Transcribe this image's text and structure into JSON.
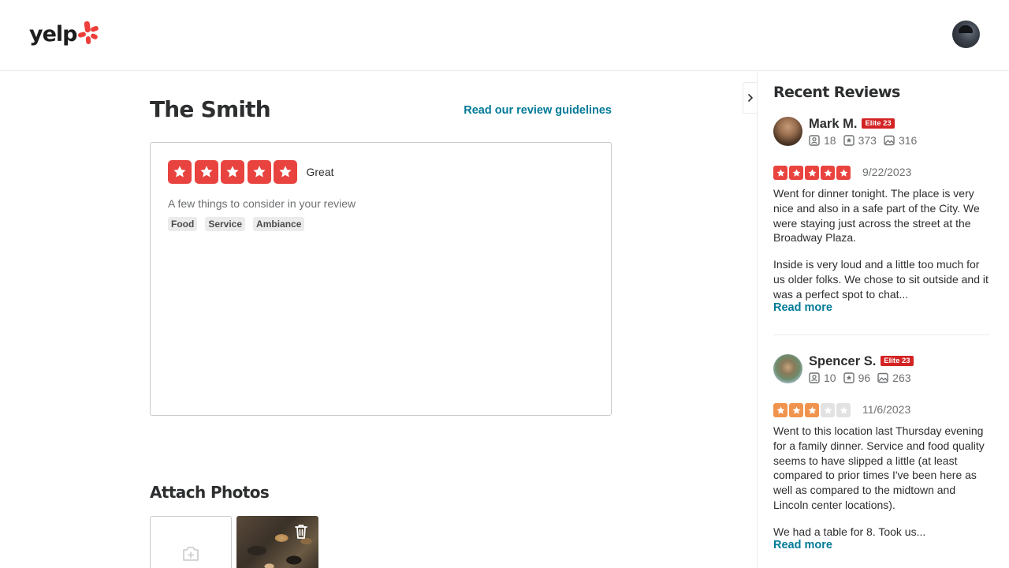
{
  "header": {
    "logo_text": "yelp",
    "brand_color": "#d32323"
  },
  "main": {
    "business_name": "The Smith",
    "guidelines_link": "Read our review guidelines",
    "rating": {
      "value": 5,
      "max": 5,
      "label": "Great",
      "color": "#e9433f"
    },
    "consider_text": "A few things to consider in your review",
    "tags": [
      "Food",
      "Service",
      "Ambiance"
    ],
    "attach_title": "Attach Photos"
  },
  "sidebar": {
    "title": "Recent Reviews",
    "reviews": [
      {
        "name": "Mark M.",
        "badge": "Elite 23",
        "friends": "18",
        "reviews": "373",
        "photos": "316",
        "rating": 5,
        "star_color": "#e9433f",
        "date": "9/22/2023",
        "paragraph1": "Went for dinner tonight. The place is very nice and also in a safe part of the City. We were staying just across the street at the Broadway Plaza.",
        "paragraph2": "Inside is very loud and a little too much for us older folks. We chose to sit outside and it was a perfect spot to chat...",
        "read_more": "Read more"
      },
      {
        "name": "Spencer S.",
        "badge": "Elite 23",
        "friends": "10",
        "reviews": "96",
        "photos": "263",
        "rating": 3,
        "star_color": "#f0944d",
        "date": "11/6/2023",
        "paragraph1": "Went to this location last Thursday evening for a family dinner. Service and food quality seems to have slipped a little (at least compared to prior times I've been here as well as compared to the midtown and Lincoln center locations).",
        "paragraph2": "We had a table for 8. Took us...",
        "read_more": "Read more"
      }
    ]
  }
}
